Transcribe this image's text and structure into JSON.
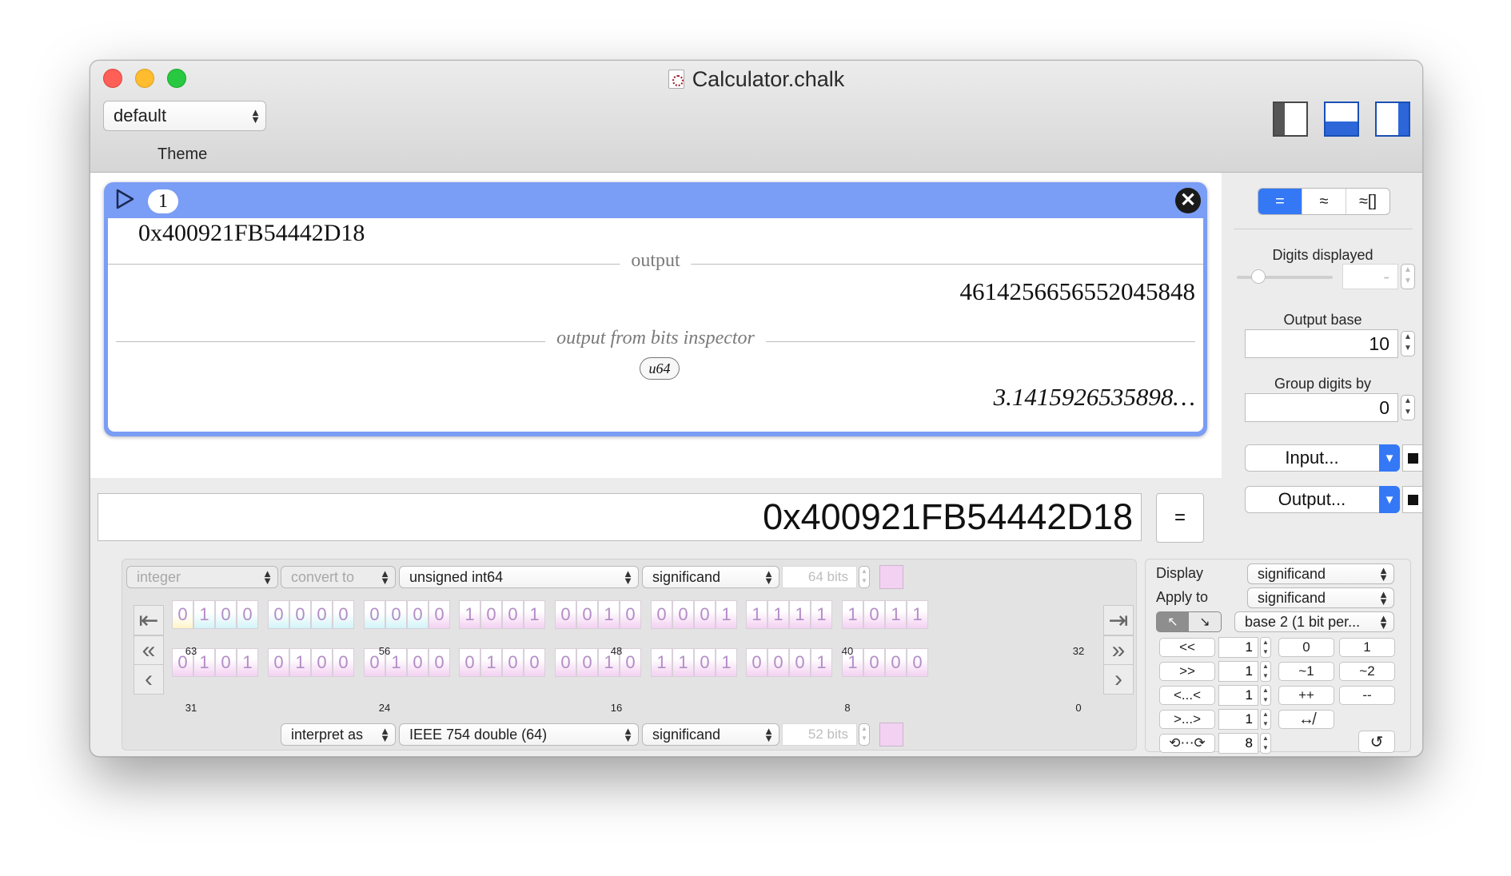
{
  "window": {
    "title": "Calculator.chalk"
  },
  "toolbar": {
    "theme_value": "default",
    "theme_label": "Theme"
  },
  "entry": {
    "index": "1",
    "expression": "0x400921FB54442D18",
    "output_label": "output",
    "output_value": "4614256656552045848",
    "bits_label": "output from bits inspector",
    "bits_type": "u64",
    "bits_value": "3.1415926535898…"
  },
  "input": {
    "value": "0x400921FB54442D18",
    "equals_label": "="
  },
  "side": {
    "mode_buttons": [
      "=",
      "≈",
      "≈[]"
    ],
    "digits_label": "Digits displayed",
    "digits_value": "-",
    "base_label": "Output base",
    "base_value": "10",
    "group_label": "Group digits by",
    "group_value": "0",
    "input_btn": "Input...",
    "output_btn": "Output..."
  },
  "inspector": {
    "row1": {
      "kind": "integer",
      "convert": "convert to",
      "type": "unsigned int64",
      "part": "significand",
      "bits": "64 bits"
    },
    "row2": {
      "interpret": "interpret as",
      "type": "IEEE 754 double (64)",
      "part": "significand",
      "bits": "52 bits"
    },
    "bits_high": "0100000000001001001000011111101101",
    "bits_hi32": "01000000000010010010000111111011",
    "bits_lo32": "01010100010001000010110100011000",
    "positions_high": [
      "63",
      "56",
      "48",
      "40",
      "32"
    ],
    "positions_low": [
      "31",
      "24",
      "16",
      "8",
      "0"
    ]
  },
  "controls": {
    "display_label": "Display",
    "display_value": "significand",
    "apply_label": "Apply to",
    "apply_value": "significand",
    "base_value": "base 2 (1 bit per...",
    "shift_left": "<<",
    "shift_right": ">>",
    "rot_left": "<...<",
    "rot_right": ">...>",
    "shift_values": [
      "1",
      "1",
      "1",
      "1"
    ],
    "swap_value": "8",
    "zero": "0",
    "one": "1",
    "not1": "~1",
    "not2": "~2",
    "inc": "++",
    "dec": "--",
    "swap_icon": "↮",
    "reset_icon": "↺"
  },
  "colors": {
    "accent": "#3478f6",
    "card": "#7a9df5",
    "bit_fill": "#f3d1f2",
    "bit_text": "#b38dc7"
  }
}
